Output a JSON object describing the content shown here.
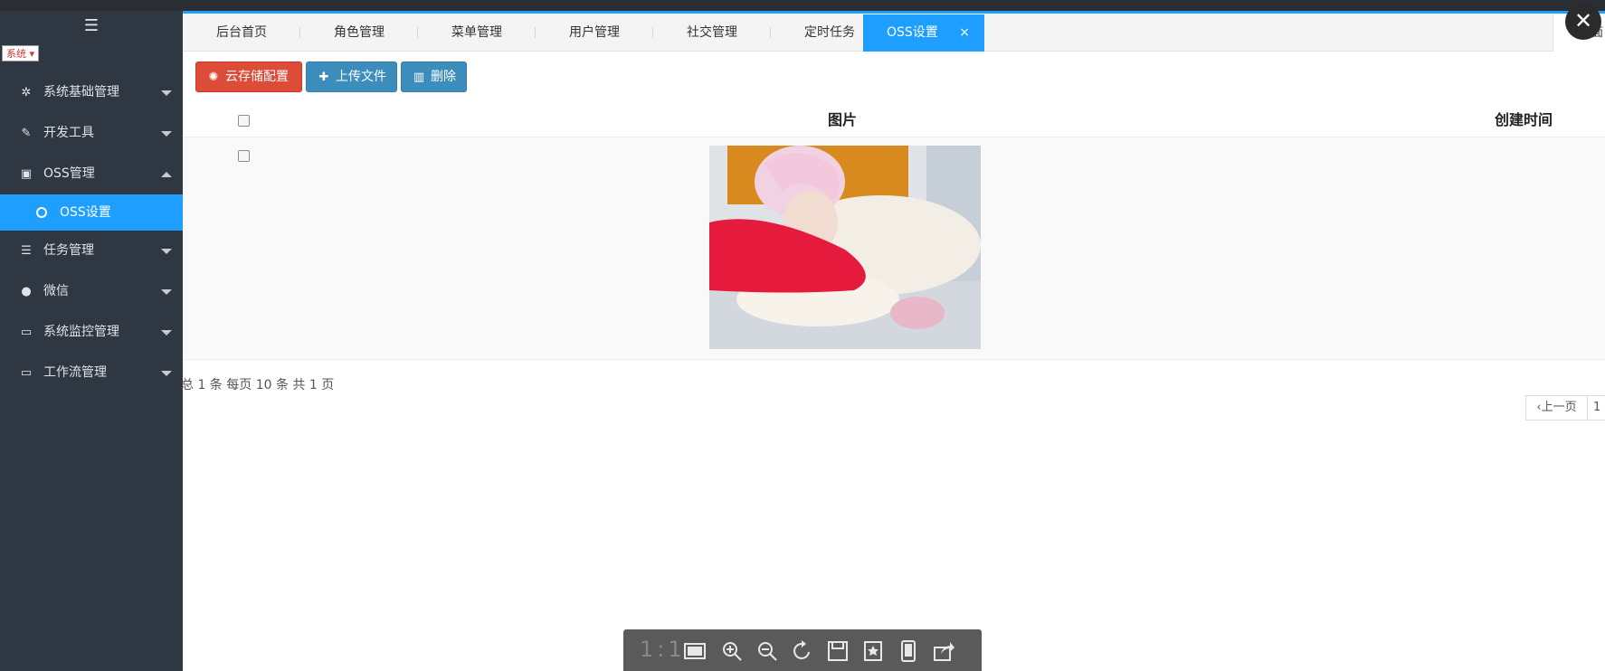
{
  "sidebar": {
    "menu_icon": "hamburger-icon",
    "system_select": "系统",
    "items": [
      {
        "label": "系统基础管理",
        "icon": "cogs-icon"
      },
      {
        "label": "开发工具",
        "icon": "wrench-icon"
      },
      {
        "label": "OSS管理",
        "icon": "file-image-icon"
      },
      {
        "label": "任务管理",
        "icon": "tasks-icon"
      },
      {
        "label": "微信",
        "icon": "wechat-icon"
      },
      {
        "label": "系统监控管理",
        "icon": "desktop-icon"
      },
      {
        "label": "工作流管理",
        "icon": "desktop-icon"
      }
    ],
    "active_sub": "OSS设置"
  },
  "tabs": [
    {
      "label": "后台首页"
    },
    {
      "label": "角色管理"
    },
    {
      "label": "菜单管理"
    },
    {
      "label": "用户管理"
    },
    {
      "label": "社交管理"
    },
    {
      "label": "定时任务"
    },
    {
      "label": "OSS设置",
      "active": true
    }
  ],
  "tab_close": "×",
  "tab_right_label": "页面",
  "toolbar": {
    "cloud_config": "云存储配置",
    "upload": "上传文件",
    "delete": "删除"
  },
  "table": {
    "headers": {
      "image": "图片",
      "created": "创建时间"
    }
  },
  "pagination": {
    "summary": "总 1 条  每页 10 条  共 1 页",
    "prev": "上一页",
    "page": "1"
  },
  "viewer": {
    "ratio": "1:1",
    "close": "✕"
  },
  "colors": {
    "sidebar_bg": "#2f3743",
    "accent": "#1e9fff",
    "danger": "#dd4b39",
    "primary": "#3c8dbc"
  }
}
